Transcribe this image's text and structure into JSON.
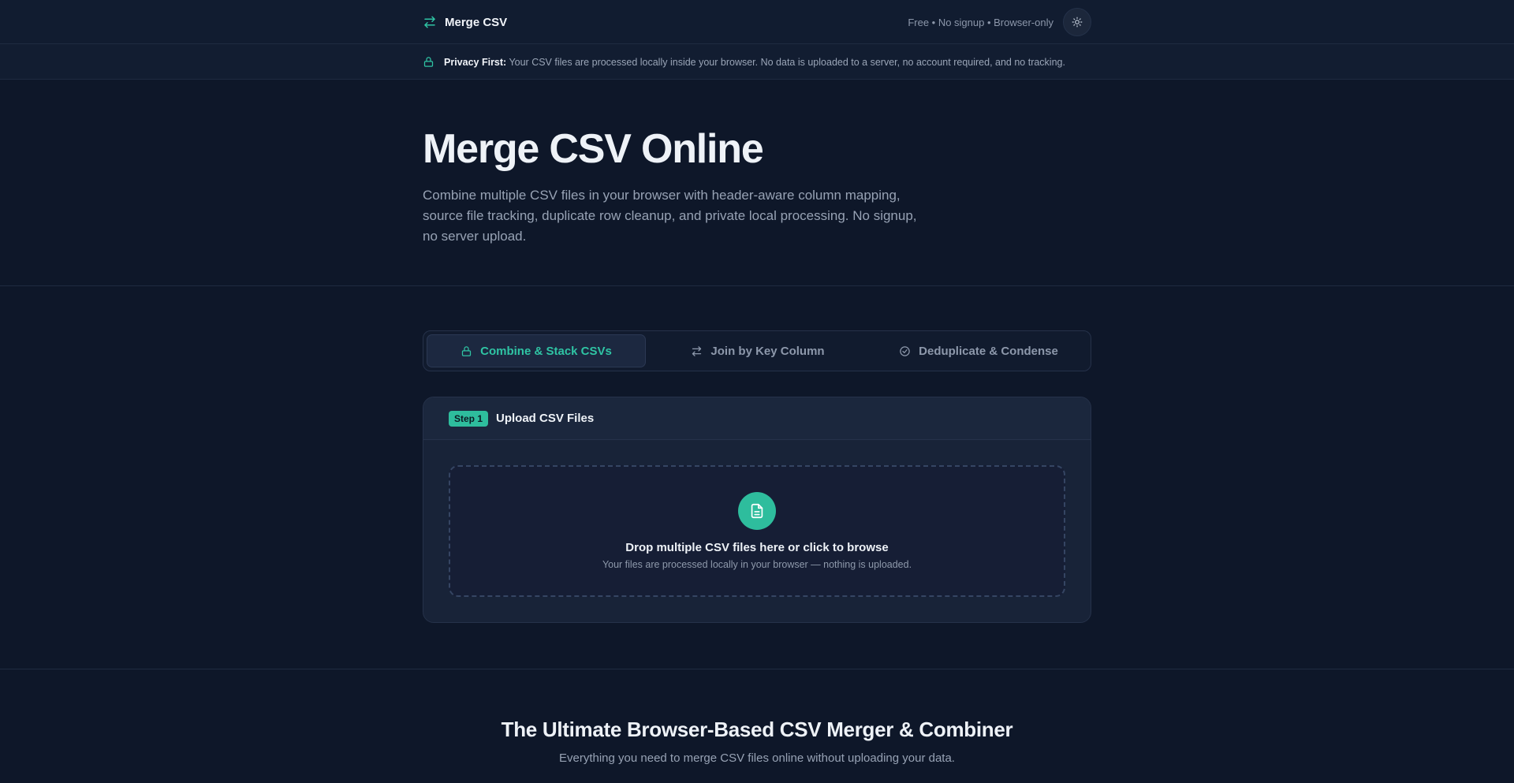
{
  "header": {
    "brand": "Merge CSV",
    "tagline": "Free • No signup • Browser-only"
  },
  "privacy": {
    "label": "Privacy First:",
    "text": " Your CSV files are processed locally inside your browser. No data is uploaded to a server, no account required, and no tracking."
  },
  "hero": {
    "title": "Merge CSV Online",
    "subtitle": "Combine multiple CSV files in your browser with header-aware column mapping, source file tracking, duplicate row cleanup, and private local processing. No signup, no server upload."
  },
  "tabs": [
    {
      "label": "Combine & Stack CSVs",
      "icon": "lock-icon",
      "active": true
    },
    {
      "label": "Join by Key Column",
      "icon": "arrows-swap-icon",
      "active": false
    },
    {
      "label": "Deduplicate & Condense",
      "icon": "check-circle-icon",
      "active": false
    }
  ],
  "step": {
    "badge": "Step 1",
    "title": "Upload CSV Files",
    "drop_title": "Drop multiple CSV files here or click to browse",
    "drop_subtitle": "Your files are processed locally in your browser — nothing is uploaded."
  },
  "features": {
    "title": "The Ultimate Browser-Based CSV Merger & Combiner",
    "subtitle": "Everything you need to merge CSV files online without uploading your data."
  },
  "colors": {
    "accent": "#2ebd9d",
    "background": "#0e1729",
    "card": "#182338"
  }
}
